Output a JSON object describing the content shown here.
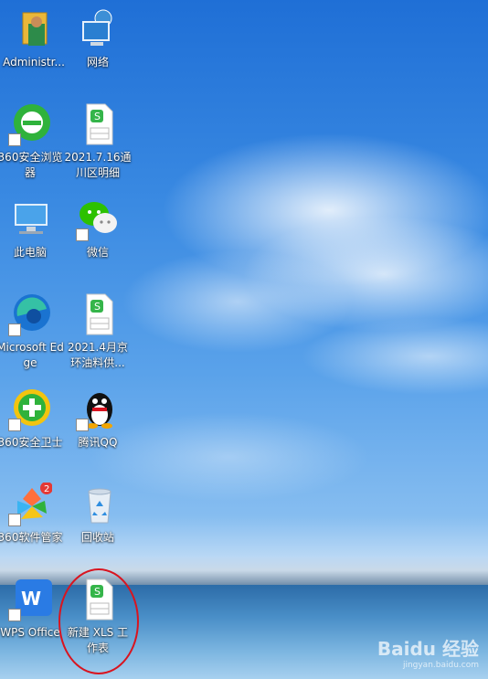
{
  "desktop": {
    "icons": [
      {
        "label": "Administr..."
      },
      {
        "label": "网络"
      },
      {
        "label": "360安全浏览器"
      },
      {
        "label": "2021.7.16通川区明细"
      },
      {
        "label": "此电脑"
      },
      {
        "label": "微信"
      },
      {
        "label": "Microsoft Edge"
      },
      {
        "label": "2021.4月京环油料供..."
      },
      {
        "label": "360安全卫士"
      },
      {
        "label": "腾讯QQ"
      },
      {
        "label": "360软件管家"
      },
      {
        "label": "回收站"
      },
      {
        "label": "WPS Office"
      },
      {
        "label": "新建 XLS 工作表"
      }
    ],
    "badge_count": "2",
    "watermark": "Baidu 经验",
    "watermark_url": "jingyan.baidu.com"
  }
}
